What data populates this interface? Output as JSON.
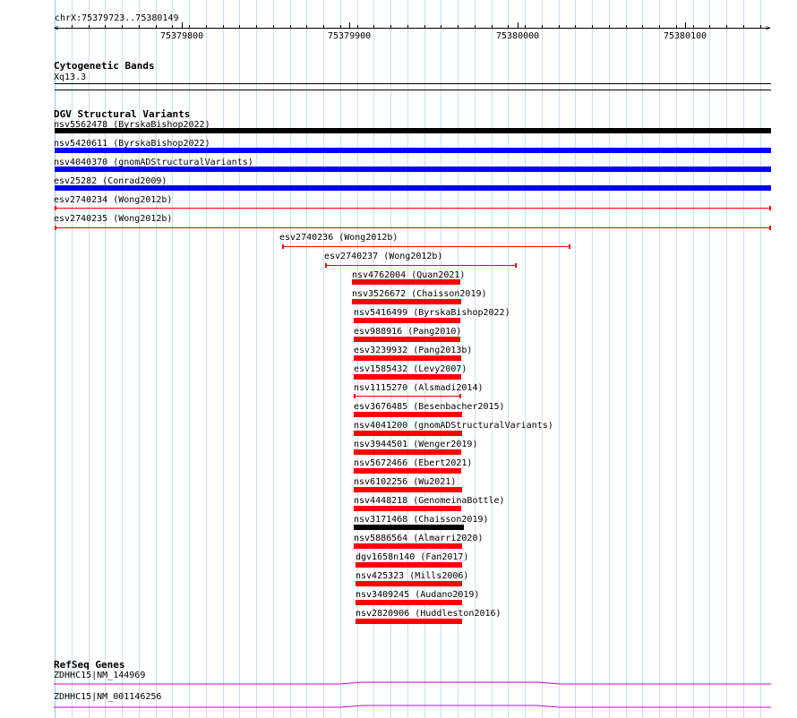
{
  "ruler": {
    "coordinates": "chrX:75379723..75380149",
    "ticks": [
      "75379800",
      "75379900",
      "75380000",
      "75380100"
    ]
  },
  "cytogenetic": {
    "title": "Cytogenetic Bands",
    "band": "Xq13.3"
  },
  "dgv": {
    "title": "DGV Structural Variants",
    "colors": {
      "black": "#000000",
      "blue": "#0000ff",
      "red": "#ff0000"
    },
    "variants": [
      {
        "label": "nsv5562478 (ByrskaBishop2022)",
        "color": "black",
        "style": "thick"
      },
      {
        "label": "nsv5420611 (ByrskaBishop2022)",
        "color": "blue",
        "style": "thick"
      },
      {
        "label": "nsv4040370 (gnomADStructuralVariants)",
        "color": "blue",
        "style": "thick"
      },
      {
        "label": "esv25282 (Conrad2009)",
        "color": "blue",
        "style": "thick"
      },
      {
        "label": "esv2740234 (Wong2012b)",
        "color": "red",
        "style": "thin"
      },
      {
        "label": "esv2740235 (Wong2012b)",
        "color": "red",
        "style": "thin"
      },
      {
        "label": "esv2740236 (Wong2012b)",
        "color": "red",
        "style": "thin"
      },
      {
        "label": "esv2740237 (Wong2012b)",
        "color": "red",
        "style": "thin"
      },
      {
        "label": "nsv4762004 (Quan2021)",
        "color": "red",
        "style": "thick"
      },
      {
        "label": "nsv3526672 (Chaisson2019)",
        "color": "red",
        "style": "thick"
      },
      {
        "label": "nsv5416499 (ByrskaBishop2022)",
        "color": "red",
        "style": "thick"
      },
      {
        "label": "esv988916 (Pang2010)",
        "color": "red",
        "style": "thick"
      },
      {
        "label": "esv3239932 (Pang2013b)",
        "color": "red",
        "style": "thick"
      },
      {
        "label": "esv1585432 (Levy2007)",
        "color": "red",
        "style": "thick"
      },
      {
        "label": "nsv1115270 (Alsmadi2014)",
        "color": "red",
        "style": "thin"
      },
      {
        "label": "esv3676485 (Besenbacher2015)",
        "color": "red",
        "style": "thick"
      },
      {
        "label": "nsv4041200 (gnomADStructuralVariants)",
        "color": "red",
        "style": "thick"
      },
      {
        "label": "nsv3944501 (Wenger2019)",
        "color": "red",
        "style": "thick"
      },
      {
        "label": "nsv5672466 (Ebert2021)",
        "color": "red",
        "style": "thick"
      },
      {
        "label": "nsv6102256 (Wu2021)",
        "color": "red",
        "style": "thick"
      },
      {
        "label": "nsv4448218 (GenomeinaBottle)",
        "color": "red",
        "style": "thick"
      },
      {
        "label": "nsv3171468 (Chaisson2019)",
        "color": "black",
        "style": "thick"
      },
      {
        "label": "nsv5886564 (Almarri2020)",
        "color": "red",
        "style": "thick"
      },
      {
        "label": "dgv1658n140 (Fan2017)",
        "color": "red",
        "style": "thick"
      },
      {
        "label": "nsv425323 (Mills2006)",
        "color": "red",
        "style": "thick"
      },
      {
        "label": "nsv3409245 (Audano2019)",
        "color": "red",
        "style": "thick"
      },
      {
        "label": "nsv2820906 (Huddleston2016)",
        "color": "red",
        "style": "thick"
      }
    ]
  },
  "refseq": {
    "title": "RefSeq Genes",
    "color": "#cc00cc",
    "genes": [
      {
        "label": "ZDHHC15|NM_144969"
      },
      {
        "label": "ZDHHC15|NM_001146256"
      }
    ]
  }
}
